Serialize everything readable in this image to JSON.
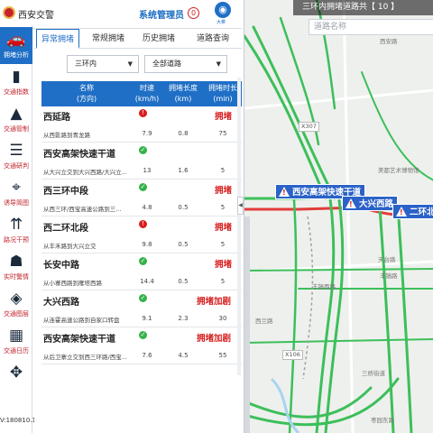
{
  "app": {
    "title": "西安交警",
    "admin_label": "系统管理员",
    "power_count": "0",
    "weather_label": "大雾",
    "version": "V:180810.1"
  },
  "nav": [
    {
      "label": "拥堵分析",
      "icon": "car-icon",
      "glyph": "🚗",
      "active": true
    },
    {
      "label": "交通指数",
      "icon": "bar-chart-icon",
      "glyph": "▮",
      "active": false
    },
    {
      "label": "交通管制",
      "icon": "traffic-cone-icon",
      "glyph": "▲",
      "active": false
    },
    {
      "label": "交通研判",
      "icon": "document-icon",
      "glyph": "☰",
      "active": false
    },
    {
      "label": "诱导简图",
      "icon": "crosshair-icon",
      "glyph": "⌖",
      "active": false
    },
    {
      "label": "路况干预",
      "icon": "road-icon",
      "glyph": "⇈",
      "active": false
    },
    {
      "label": "实时警情",
      "icon": "police-icon",
      "glyph": "☗",
      "active": false
    },
    {
      "label": "交通图层",
      "icon": "layers-icon",
      "glyph": "◈",
      "active": false
    },
    {
      "label": "交通日历",
      "icon": "calendar-icon",
      "glyph": "▦",
      "active": false
    },
    {
      "label": "",
      "icon": "compass-icon",
      "glyph": "✥",
      "active": false
    }
  ],
  "tabs": [
    {
      "label": "异常拥堵",
      "active": true
    },
    {
      "label": "常规拥堵",
      "active": false
    },
    {
      "label": "历史拥堵",
      "active": false
    },
    {
      "label": "道路查询",
      "active": false
    }
  ],
  "filters": {
    "ring": "三环内",
    "road_type": "全部道路"
  },
  "table": {
    "headers": {
      "name": "名称",
      "name_sub": "(方向)",
      "speed": "时速",
      "speed_unit": "(km/h)",
      "length": "拥堵长度",
      "length_unit": "(km)",
      "duration": "拥堵时长",
      "duration_unit": "(min)"
    },
    "rows": [
      {
        "name": "西延路",
        "desc": "从西影路到青龙路",
        "status_icon": "red",
        "status": "拥堵",
        "speed": "7.9",
        "length": "0.8",
        "duration": "75"
      },
      {
        "name": "西安高架快速干道",
        "desc": "从大兴立交到大兴西路/大兴立...",
        "status_icon": "green",
        "status": "",
        "speed": "13",
        "length": "1.6",
        "duration": "5"
      },
      {
        "name": "西三环中段",
        "desc": "从西三环/西宝高速公路到三...",
        "status_icon": "green",
        "status": "拥堵",
        "speed": "4.8",
        "length": "0.5",
        "duration": "5"
      },
      {
        "name": "西二环北段",
        "desc": "从丰禾路到大兴立交",
        "status_icon": "red",
        "status": "拥堵",
        "speed": "9.8",
        "length": "0.5",
        "duration": "5"
      },
      {
        "name": "长安中路",
        "desc": "从小寨西路到雁塔西路",
        "status_icon": "green",
        "status": "拥堵",
        "speed": "14.4",
        "length": "0.5",
        "duration": "5"
      },
      {
        "name": "大兴西路",
        "desc": "从连霍高速公路到自家口转盘",
        "status_icon": "green",
        "status": "拥堵加剧",
        "speed": "9.1",
        "length": "2.3",
        "duration": "30"
      },
      {
        "name": "西安高架快速干道",
        "desc": "从后卫寨立交到西三环路/西宝...",
        "status_icon": "green",
        "status": "拥堵加剧",
        "speed": "7.6",
        "length": "4.5",
        "duration": "55"
      }
    ]
  },
  "map": {
    "title": "三环内拥堵道路共【 10 】",
    "search_placeholder": "道路名称",
    "callouts": [
      {
        "label": "西安高架快速干道"
      },
      {
        "label": "大兴西路"
      },
      {
        "label": "二环北段"
      }
    ],
    "labels": {
      "x307": "X307",
      "x106": "X106",
      "road_xinan": "西安路",
      "museum": "美都艺术博物馆",
      "fenghe": "丰镐西路",
      "fengcheng": "丰镐路",
      "tiantai": "天台路",
      "xiluan": "西兰路",
      "zaoyuan": "枣园东路",
      "sanqiao": "三桥街道"
    },
    "colors": {
      "jam": "#e33b3b",
      "free": "#3cbf5a",
      "slow": "#f2b705",
      "callout": "#2a62c8"
    }
  }
}
